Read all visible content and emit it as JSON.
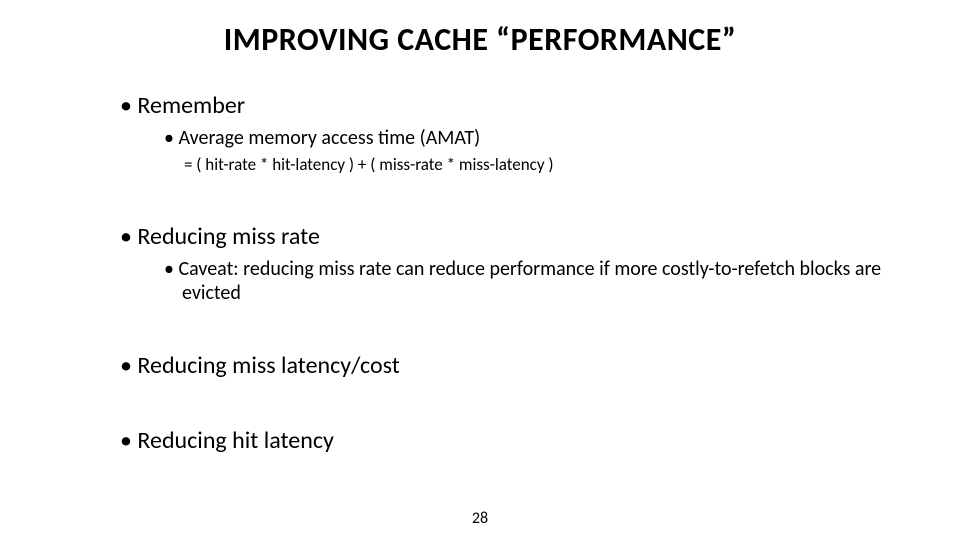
{
  "title": "IMPROVING CACHE “PERFORMANCE”",
  "bullets": {
    "remember": {
      "label": "Remember",
      "sub": {
        "amat_label": "Average memory access time (AMAT)",
        "amat_formula": "= ( hit-rate * hit-latency ) + ( miss-rate * miss-latency )"
      }
    },
    "missrate": {
      "label": "Reducing miss rate",
      "sub": {
        "caveat": "Caveat: reducing miss rate can reduce performance if more costly-to-refetch blocks are evicted"
      }
    },
    "misslatency": {
      "label": "Reducing miss latency/cost"
    },
    "hitlatency": {
      "label": "Reducing hit latency"
    }
  },
  "page_number": "28"
}
